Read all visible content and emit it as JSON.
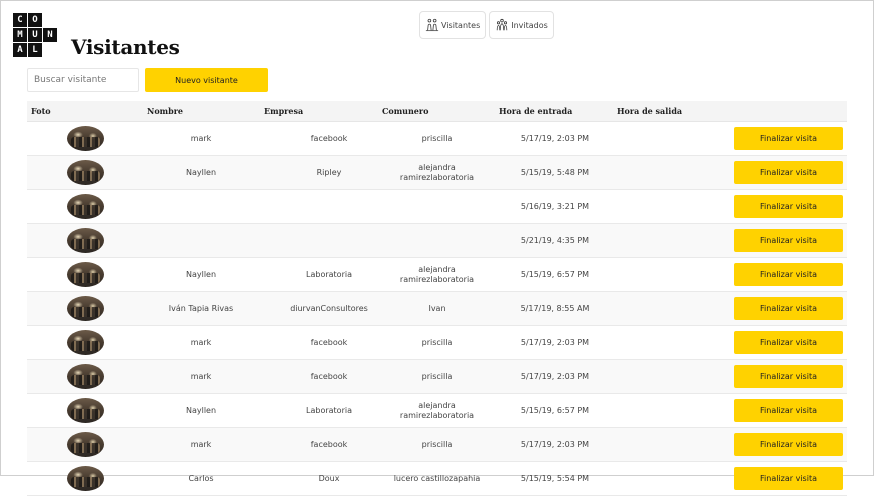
{
  "logo": {
    "letters": [
      "C",
      "O",
      "",
      "M",
      "U",
      "N",
      "A",
      "L",
      ""
    ]
  },
  "page": {
    "title": "Visitantes"
  },
  "tabs": [
    {
      "label": "Visitantes",
      "icon": "visitors-icon"
    },
    {
      "label": "Invitados",
      "icon": "guests-icon"
    }
  ],
  "search": {
    "placeholder": "Buscar visitante",
    "value": ""
  },
  "new_button": {
    "label": "Nuevo visitante"
  },
  "colors": {
    "accent": "#ffd200",
    "header_bg": "#f4f4f4"
  },
  "table": {
    "headers": {
      "foto": "Foto",
      "nombre": "Nombre",
      "empresa": "Empresa",
      "comunero": "Comunero",
      "hora_entrada": "Hora de entrada",
      "hora_salida": "Hora de salida"
    },
    "rows": [
      {
        "nombre": "mark",
        "empresa": "facebook",
        "comunero": "priscilla",
        "hora_entrada": "5/17/19, 2:03 PM",
        "hora_salida": "",
        "action": "Finalizar visita"
      },
      {
        "nombre": "Nayllen",
        "empresa": "Ripley",
        "comunero": "alejandra ramirezlaboratoria",
        "hora_entrada": "5/15/19, 5:48 PM",
        "hora_salida": "",
        "action": "Finalizar visita"
      },
      {
        "nombre": "",
        "empresa": "",
        "comunero": "",
        "hora_entrada": "5/16/19, 3:21 PM",
        "hora_salida": "",
        "action": "Finalizar visita"
      },
      {
        "nombre": "",
        "empresa": "",
        "comunero": "",
        "hora_entrada": "5/21/19, 4:35 PM",
        "hora_salida": "",
        "action": "Finalizar visita"
      },
      {
        "nombre": "Nayllen",
        "empresa": "Laboratoria",
        "comunero": "alejandra ramirezlaboratoria",
        "hora_entrada": "5/15/19, 6:57 PM",
        "hora_salida": "",
        "action": "Finalizar visita"
      },
      {
        "nombre": "Iván Tapia Rivas",
        "empresa": "diurvanConsultores",
        "comunero": "Ivan",
        "hora_entrada": "5/17/19, 8:55 AM",
        "hora_salida": "",
        "action": "Finalizar visita"
      },
      {
        "nombre": "mark",
        "empresa": "facebook",
        "comunero": "priscilla",
        "hora_entrada": "5/17/19, 2:03 PM",
        "hora_salida": "",
        "action": "Finalizar visita"
      },
      {
        "nombre": "mark",
        "empresa": "facebook",
        "comunero": "priscilla",
        "hora_entrada": "5/17/19, 2:03 PM",
        "hora_salida": "",
        "action": "Finalizar visita"
      },
      {
        "nombre": "Nayllen",
        "empresa": "Laboratoria",
        "comunero": "alejandra ramirezlaboratoria",
        "hora_entrada": "5/15/19, 6:57 PM",
        "hora_salida": "",
        "action": "Finalizar visita"
      },
      {
        "nombre": "mark",
        "empresa": "facebook",
        "comunero": "priscilla",
        "hora_entrada": "5/17/19, 2:03 PM",
        "hora_salida": "",
        "action": "Finalizar visita"
      },
      {
        "nombre": "Carlos",
        "empresa": "Doux",
        "comunero": "lucero castillozapahia",
        "hora_entrada": "5/15/19, 5:54 PM",
        "hora_salida": "",
        "action": "Finalizar visita"
      }
    ]
  }
}
